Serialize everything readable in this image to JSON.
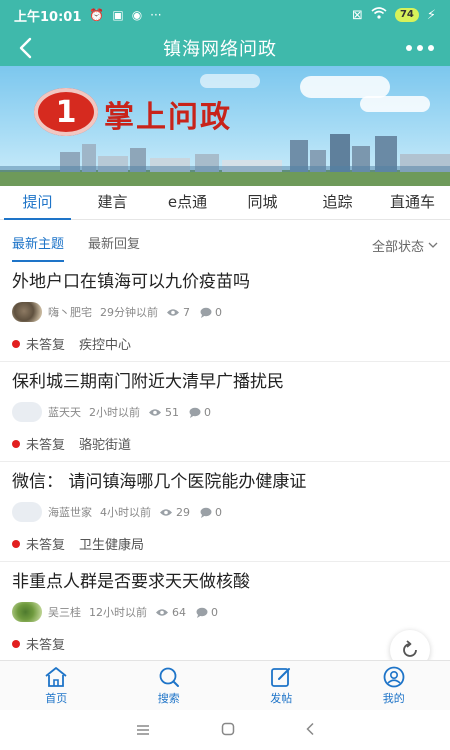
{
  "status_bar": {
    "time": "上午10:01",
    "dots": "···",
    "battery": "74"
  },
  "header": {
    "title": "镇海网络问政"
  },
  "banner": {
    "logo_text": "1",
    "title": "掌上问政"
  },
  "tabs": [
    {
      "label": "提问"
    },
    {
      "label": "建言"
    },
    {
      "label": "e点通"
    },
    {
      "label": "同城"
    },
    {
      "label": "追踪"
    },
    {
      "label": "直通车"
    }
  ],
  "subtabs": {
    "latest_topics": "最新主题",
    "latest_replies": "最新回复",
    "status_filter": "全部状态"
  },
  "posts": [
    {
      "question": "外地户口在镇海可以九价疫苗吗",
      "user": "嗨丶肥宅",
      "time": "29分钟以前",
      "views": "7",
      "comments": "0",
      "status": "未答复",
      "category": "疾控中心"
    },
    {
      "question": "保利城三期南门附近大清早广播扰民",
      "user": "蓝天天",
      "time": "2小时以前",
      "views": "51",
      "comments": "0",
      "status": "未答复",
      "category": "骆驼街道"
    },
    {
      "question": "微信：  请问镇海哪几个医院能办健康证",
      "user": "海蓝世家",
      "time": "4小时以前",
      "views": "29",
      "comments": "0",
      "status": "未答复",
      "category": "卫生健康局"
    },
    {
      "question": "非重点人群是否要求天天做核酸",
      "user": "吴三桂",
      "time": "12小时以前",
      "views": "64",
      "comments": "0",
      "status": "未答复",
      "category": ""
    }
  ],
  "bottom_nav": [
    {
      "label": "首页",
      "icon": "home-icon"
    },
    {
      "label": "搜索",
      "icon": "search-icon"
    },
    {
      "label": "发帖",
      "icon": "compose-icon"
    },
    {
      "label": "我的",
      "icon": "user-icon"
    }
  ],
  "colors": {
    "brand": "#3fb9ab",
    "accent": "#1e74c8",
    "status_dot": "#e21f1f"
  }
}
